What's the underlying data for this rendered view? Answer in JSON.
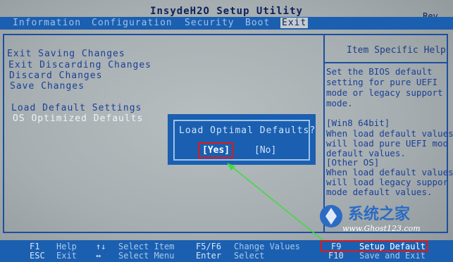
{
  "header": {
    "title": "InsydeH2O Setup Utility",
    "rev": "Rev."
  },
  "menu": [
    {
      "label": "Information"
    },
    {
      "label": "Configuration"
    },
    {
      "label": "Security"
    },
    {
      "label": "Boot"
    },
    {
      "label": "Exit",
      "active": true
    }
  ],
  "left_menu": {
    "items": [
      "Exit Saving Changes",
      "Exit Discarding Changes",
      "Discard Changes",
      "Save Changes",
      "Load Default Settings",
      "OS Optimized Defaults"
    ]
  },
  "help": {
    "title": "Item Specific Help",
    "lines": [
      "Set the BIOS default",
      "setting for pure UEFI",
      "mode or legacy support",
      "mode.",
      "[Win8 64bit]",
      "When load default values",
      " will load pure UEFI mod",
      "default values.",
      "[Other OS]",
      "When load default values,",
      " will load legacy suppor",
      "mode default values."
    ]
  },
  "dialog": {
    "message": "Load Optimal Defaults?",
    "yes_label": "[Yes]",
    "no_label": "[No]"
  },
  "footer": {
    "keys": [
      {
        "key": "F1",
        "desc": "Help"
      },
      {
        "key": "ESC",
        "desc": "Exit"
      },
      {
        "key": "↑↓",
        "desc": "Select Item"
      },
      {
        "key": "↔",
        "desc": "Select Menu"
      },
      {
        "key": "F5/F6",
        "desc": "Change Values"
      },
      {
        "key": "Enter",
        "desc": "Select"
      },
      {
        "key": "F9",
        "desc": "Setup Default"
      },
      {
        "key": "F10",
        "desc": "Save and Exit"
      }
    ]
  },
  "watermark": {
    "brand": "系统之家",
    "url": "www.Ghost123.com"
  },
  "colors": {
    "bios_blue": "#1b5fb0",
    "screen_grey": "#aeb6b8",
    "highlight_red": "#e01818",
    "arrow_green": "#3ddc3d"
  }
}
